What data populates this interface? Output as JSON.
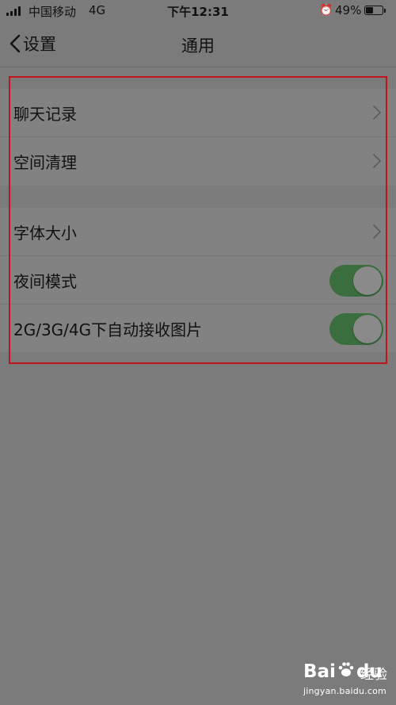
{
  "status_bar": {
    "carrier": "中国移动",
    "network": "4G",
    "time": "下午12:31",
    "alarm_icon": "alarm-clock-icon",
    "battery_percent": "49%",
    "battery_level": 0.49
  },
  "nav": {
    "back_label": "设置",
    "title": "通用"
  },
  "group_1": {
    "items": [
      {
        "label": "聊天记录",
        "type": "link"
      },
      {
        "label": "空间清理",
        "type": "link"
      }
    ]
  },
  "group_2": {
    "items": [
      {
        "label": "字体大小",
        "type": "link"
      },
      {
        "label": "夜间模式",
        "type": "toggle",
        "on": true
      },
      {
        "label": "2G/3G/4G下自动接收图片",
        "type": "toggle",
        "on": true
      }
    ]
  },
  "colors": {
    "background": "#7b7b7b",
    "toggle_on": "#3b6e3e",
    "highlight": "#c0141c"
  },
  "watermark": {
    "logo_text_1": "Bai",
    "logo_text_2": "du",
    "name": "经验",
    "url": "jingyan.baidu.com"
  }
}
